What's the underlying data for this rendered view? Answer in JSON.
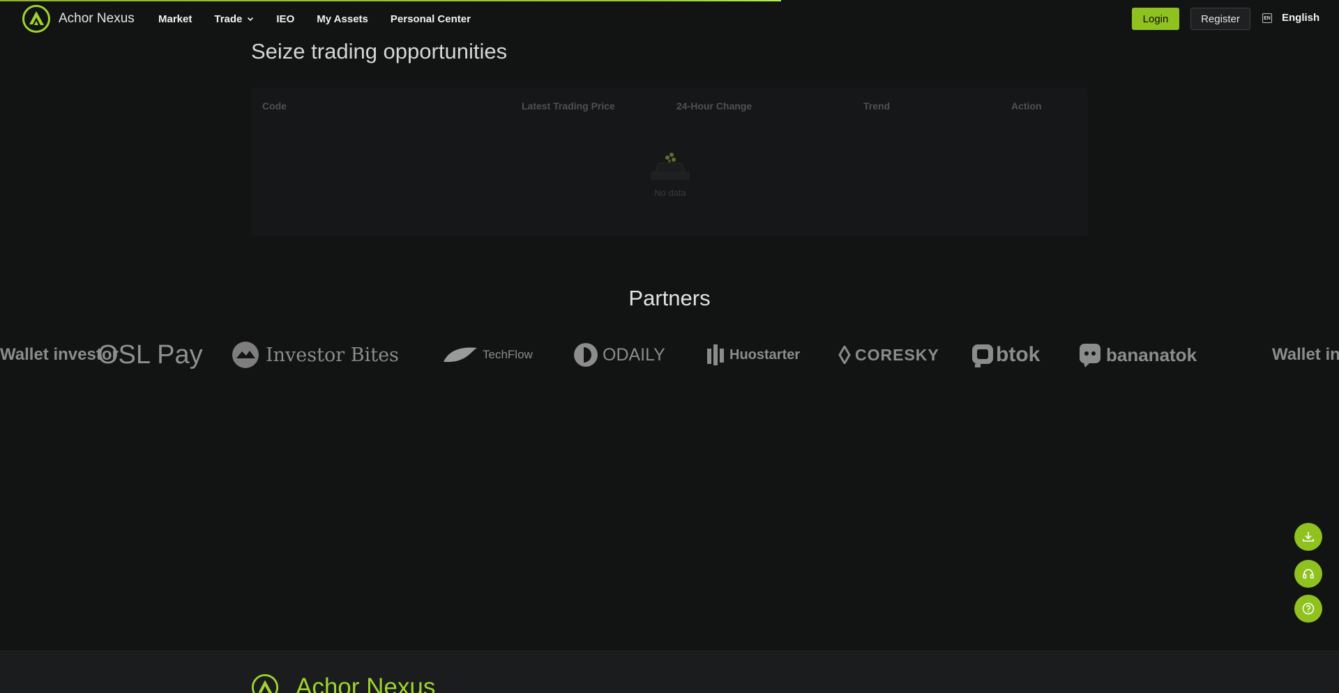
{
  "brand": {
    "name": "Achor Nexus",
    "accent": "#8fc21f"
  },
  "nav": {
    "items": [
      {
        "label": "Market"
      },
      {
        "label": "Trade",
        "has_dropdown": true
      },
      {
        "label": "IEO"
      },
      {
        "label": "My Assets"
      },
      {
        "label": "Personal Center"
      }
    ]
  },
  "auth": {
    "login_label": "Login",
    "register_label": "Register"
  },
  "language": {
    "badge": "EN",
    "label": "English"
  },
  "market": {
    "title": "Seize trading opportunities",
    "columns": [
      "Code",
      "Latest Trading Price",
      "24-Hour Change",
      "Trend",
      "Action"
    ],
    "empty_text": "No data"
  },
  "partners": {
    "title": "Partners",
    "logos": [
      {
        "name": "Wallet investor",
        "icon": "wallet-investor-logo"
      },
      {
        "name": "OSL Pay",
        "icon": "osl-pay-logo"
      },
      {
        "name": "Investor Bites",
        "icon": "investor-bites-logo"
      },
      {
        "name": "TechFlow",
        "icon": "techflow-logo"
      },
      {
        "name": "ODAILY",
        "icon": "odaily-logo"
      },
      {
        "name": "Huostarter",
        "icon": "huostarter-logo"
      },
      {
        "name": "CORESKY",
        "icon": "coresky-logo"
      },
      {
        "name": "btok",
        "icon": "btok-logo"
      },
      {
        "name": "bananatok",
        "icon": "bananatok-logo"
      },
      {
        "name": "Wallet investor",
        "icon": "wallet-investor-logo"
      }
    ]
  },
  "floating_actions": [
    {
      "icon": "download-icon"
    },
    {
      "icon": "headset-icon"
    },
    {
      "icon": "help-icon"
    }
  ],
  "footer": {
    "brand_name": "Achor Nexus"
  }
}
